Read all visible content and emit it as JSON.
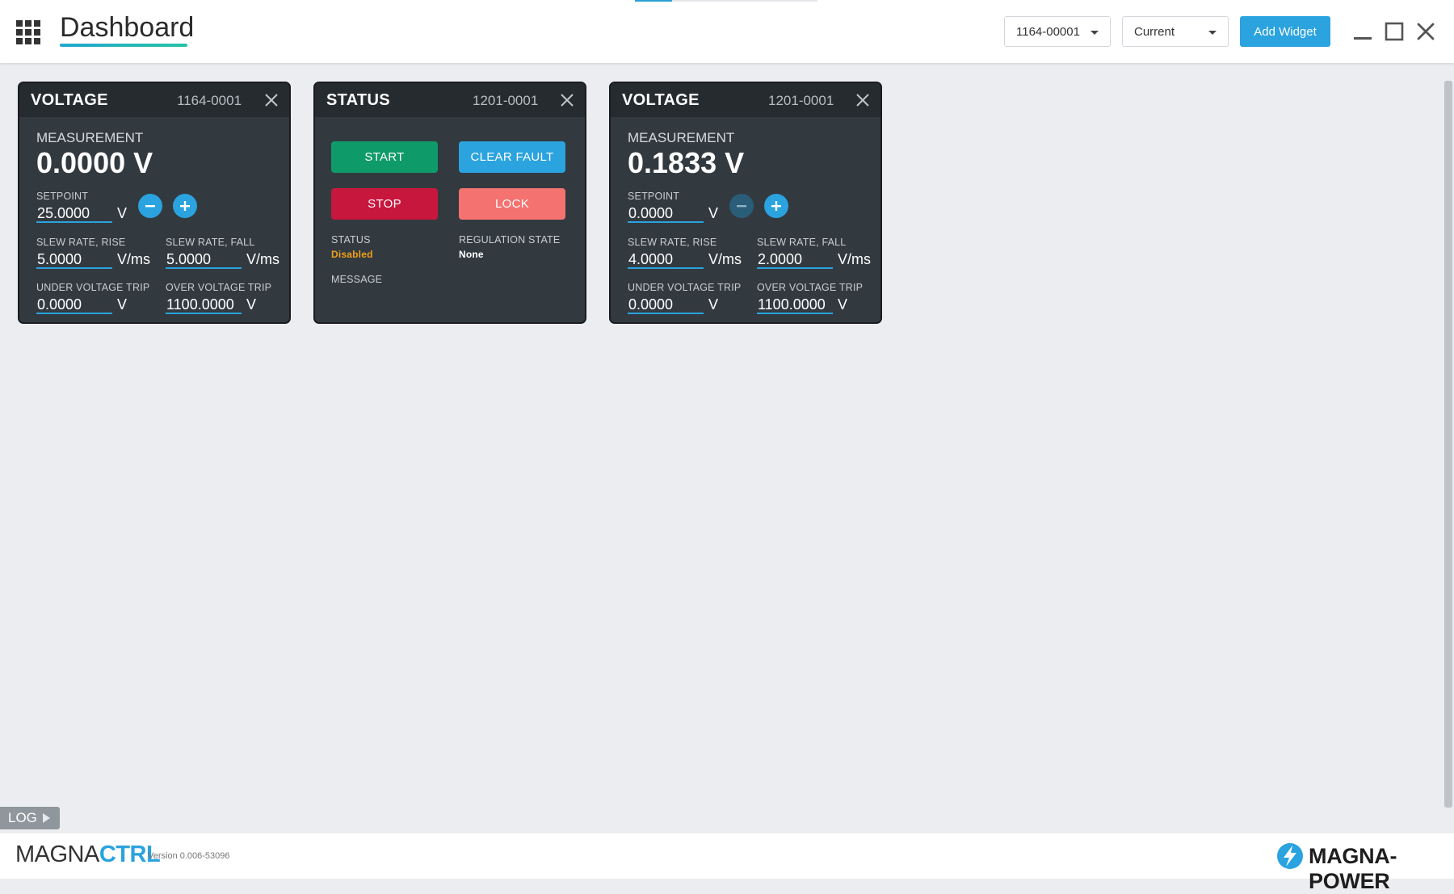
{
  "header": {
    "title": "Dashboard",
    "device_select": "1164-00001",
    "mode_select": "Current",
    "add_widget_label": "Add Widget"
  },
  "widgets": [
    {
      "title": "VOLTAGE",
      "device_id": "1164-0001",
      "measurement_label": "MEASUREMENT",
      "measurement_value": "0.0000 V",
      "setpoint_label": "SETPOINT",
      "setpoint_value": "25.0000",
      "setpoint_unit": "V",
      "slew_rise_label": "SLEW RATE, RISE",
      "slew_rise_value": "5.0000",
      "slew_rise_unit": "V/ms",
      "slew_fall_label": "SLEW RATE, FALL",
      "slew_fall_value": "5.0000",
      "slew_fall_unit": "V/ms",
      "uvt_label": "UNDER VOLTAGE TRIP",
      "uvt_value": "0.0000",
      "uvt_unit": "V",
      "ovt_label": "OVER VOLTAGE TRIP",
      "ovt_value": "1100.0000",
      "ovt_unit": "V"
    },
    {
      "title": "STATUS",
      "device_id": "1201-0001",
      "start_label": "START",
      "clear_fault_label": "CLEAR FAULT",
      "stop_label": "STOP",
      "lock_label": "LOCK",
      "status_label": "STATUS",
      "status_value": "Disabled",
      "regulation_label": "REGULATION STATE",
      "regulation_value": "None",
      "message_label": "MESSAGE"
    },
    {
      "title": "VOLTAGE",
      "device_id": "1201-0001",
      "measurement_label": "MEASUREMENT",
      "measurement_value": "0.1833 V",
      "setpoint_label": "SETPOINT",
      "setpoint_value": "0.0000",
      "setpoint_unit": "V",
      "slew_rise_label": "SLEW RATE, RISE",
      "slew_rise_value": "4.0000",
      "slew_rise_unit": "V/ms",
      "slew_fall_label": "SLEW RATE, FALL",
      "slew_fall_value": "2.0000",
      "slew_fall_unit": "V/ms",
      "uvt_label": "UNDER VOLTAGE TRIP",
      "uvt_value": "0.0000",
      "uvt_unit": "V",
      "ovt_label": "OVER VOLTAGE TRIP",
      "ovt_value": "1100.0000",
      "ovt_unit": "V"
    }
  ],
  "log_tab_label": "LOG",
  "footer": {
    "brand_part1": "MAGNA",
    "brand_part2": "CTRL",
    "version": "Version 0.006-53096",
    "company": "MAGNA-POWER"
  },
  "colors": {
    "accent": "#2aa3df",
    "start": "#0f9a6a",
    "stop": "#c8173d",
    "lock": "#f4726f",
    "status_disabled": "#f0a01a",
    "widget_bg": "#323a40"
  }
}
